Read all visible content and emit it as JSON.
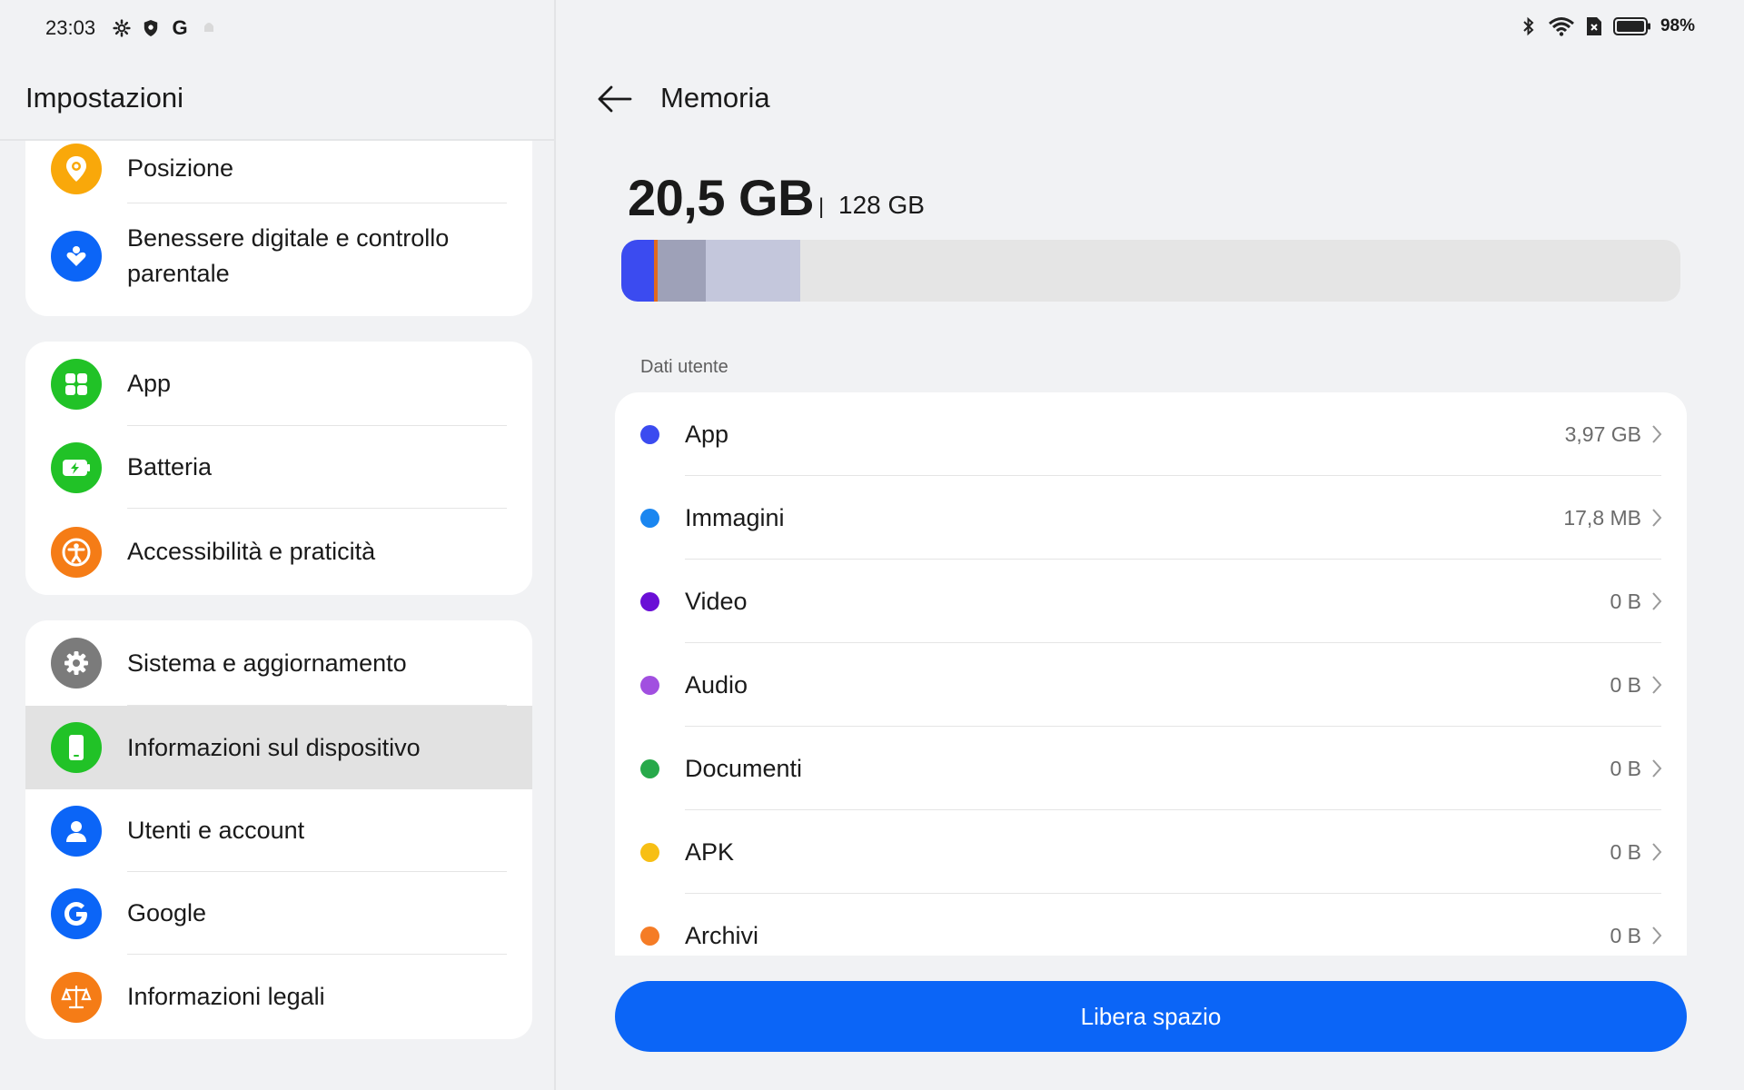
{
  "status_bar": {
    "time": "23:03",
    "left_icons": [
      "gear-icon",
      "shield-icon",
      "google-g-icon",
      "dim-notification-icon"
    ],
    "right_icons": [
      "bluetooth-icon",
      "wifi-icon",
      "sim-off-icon",
      "battery-icon"
    ],
    "battery_percent": "98%"
  },
  "left_pane": {
    "title": "Impostazioni",
    "groups": [
      {
        "items": [
          {
            "label": "Posizione",
            "icon": "location-pin-icon",
            "color": "#f9a80a"
          },
          {
            "label": "Benessere digitale e controllo parentale",
            "icon": "heart-person-icon",
            "color": "#0b65f7"
          }
        ]
      },
      {
        "items": [
          {
            "label": "App",
            "icon": "apps-grid-icon",
            "color": "#21c227"
          },
          {
            "label": "Batteria",
            "icon": "battery-charging-icon",
            "color": "#21c227"
          },
          {
            "label": "Accessibilità e praticità",
            "icon": "accessibility-icon",
            "color": "#f57c16"
          }
        ]
      },
      {
        "items": [
          {
            "label": "Sistema e aggiornamento",
            "icon": "gear-icon",
            "color": "#7b7b7b"
          },
          {
            "label": "Informazioni sul dispositivo",
            "icon": "phone-device-icon",
            "color": "#21c227",
            "selected": true
          },
          {
            "label": "Utenti e account",
            "icon": "user-icon",
            "color": "#0b65f7"
          },
          {
            "label": "Google",
            "icon": "google-g-icon",
            "color": "#0b65f7"
          },
          {
            "label": "Informazioni legali",
            "icon": "scales-icon",
            "color": "#f57c16"
          }
        ]
      }
    ]
  },
  "right_pane": {
    "title": "Memoria",
    "used": "20,5 GB",
    "separator": "|",
    "total": "128 GB",
    "usage_segments": [
      {
        "fraction": 0.031,
        "color": "#3b4bf0"
      },
      {
        "fraction": 0.003,
        "color": "#e26a1e"
      },
      {
        "fraction": 0.046,
        "color": "#9ea1b8"
      },
      {
        "fraction": 0.089,
        "color": "#c4c7dc"
      }
    ],
    "section_label": "Dati utente",
    "categories": [
      {
        "label": "App",
        "value": "3,97 GB",
        "color": "#3b4bf0"
      },
      {
        "label": "Immagini",
        "value": "17,8 MB",
        "color": "#1a86f0"
      },
      {
        "label": "Video",
        "value": "0 B",
        "color": "#6a0fd6"
      },
      {
        "label": "Audio",
        "value": "0 B",
        "color": "#a14fe0"
      },
      {
        "label": "Documenti",
        "value": "0 B",
        "color": "#27a94a"
      },
      {
        "label": "APK",
        "value": "0 B",
        "color": "#f7bf15"
      },
      {
        "label": "Archivi",
        "value": "0 B",
        "color": "#f57c26"
      }
    ],
    "button_label": "Libera spazio"
  }
}
